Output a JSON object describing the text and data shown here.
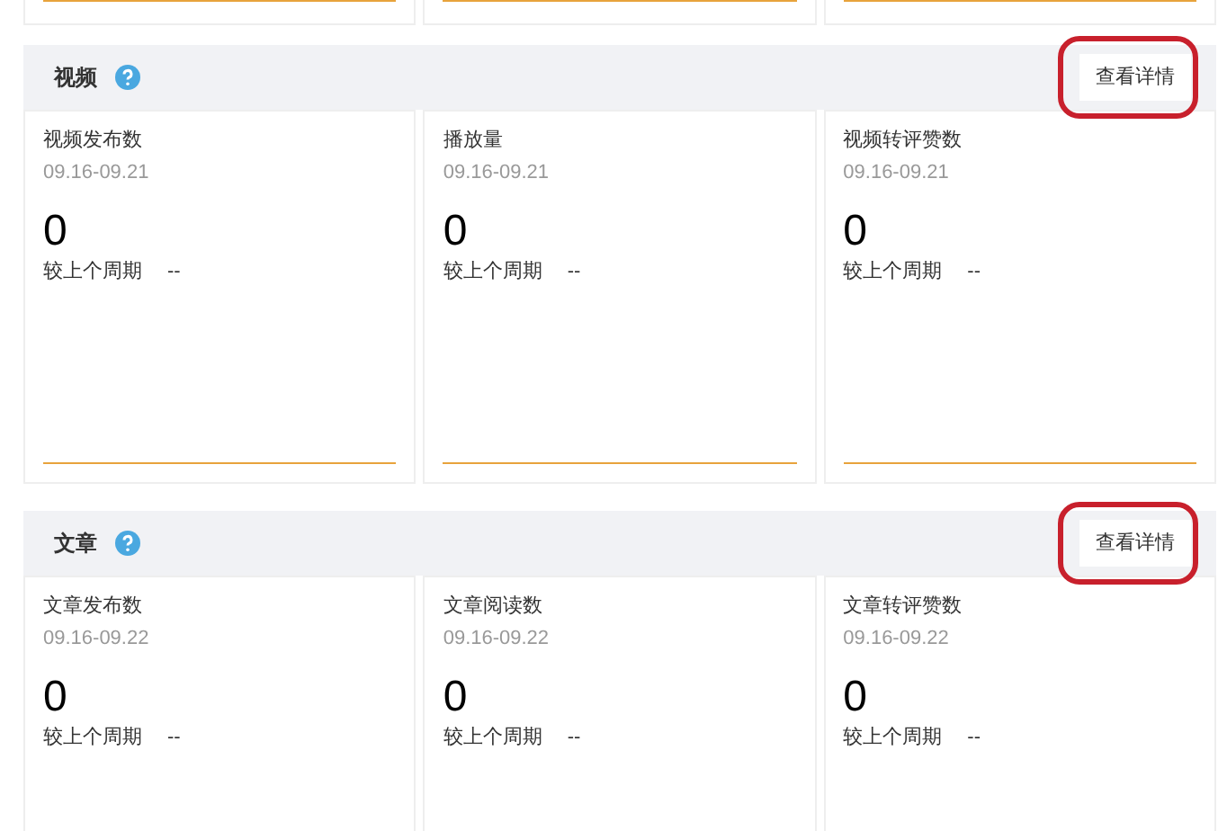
{
  "sections": [
    {
      "title": "视频",
      "button": "查看详情",
      "highlighted": true,
      "cards": [
        {
          "title": "视频发布数",
          "period": "09.16-09.21",
          "value": "0",
          "compare_label": "较上个周期",
          "compare_value": "--"
        },
        {
          "title": "播放量",
          "period": "09.16-09.21",
          "value": "0",
          "compare_label": "较上个周期",
          "compare_value": "--"
        },
        {
          "title": "视频转评赞数",
          "period": "09.16-09.21",
          "value": "0",
          "compare_label": "较上个周期",
          "compare_value": "--"
        }
      ]
    },
    {
      "title": "文章",
      "button": "查看详情",
      "highlighted": true,
      "cards": [
        {
          "title": "文章发布数",
          "period": "09.16-09.22",
          "value": "0",
          "compare_label": "较上个周期",
          "compare_value": "--"
        },
        {
          "title": "文章阅读数",
          "period": "09.16-09.22",
          "value": "0",
          "compare_label": "较上个周期",
          "compare_value": "--"
        },
        {
          "title": "文章转评赞数",
          "period": "09.16-09.22",
          "value": "0",
          "compare_label": "较上个周期",
          "compare_value": "--"
        }
      ]
    }
  ]
}
